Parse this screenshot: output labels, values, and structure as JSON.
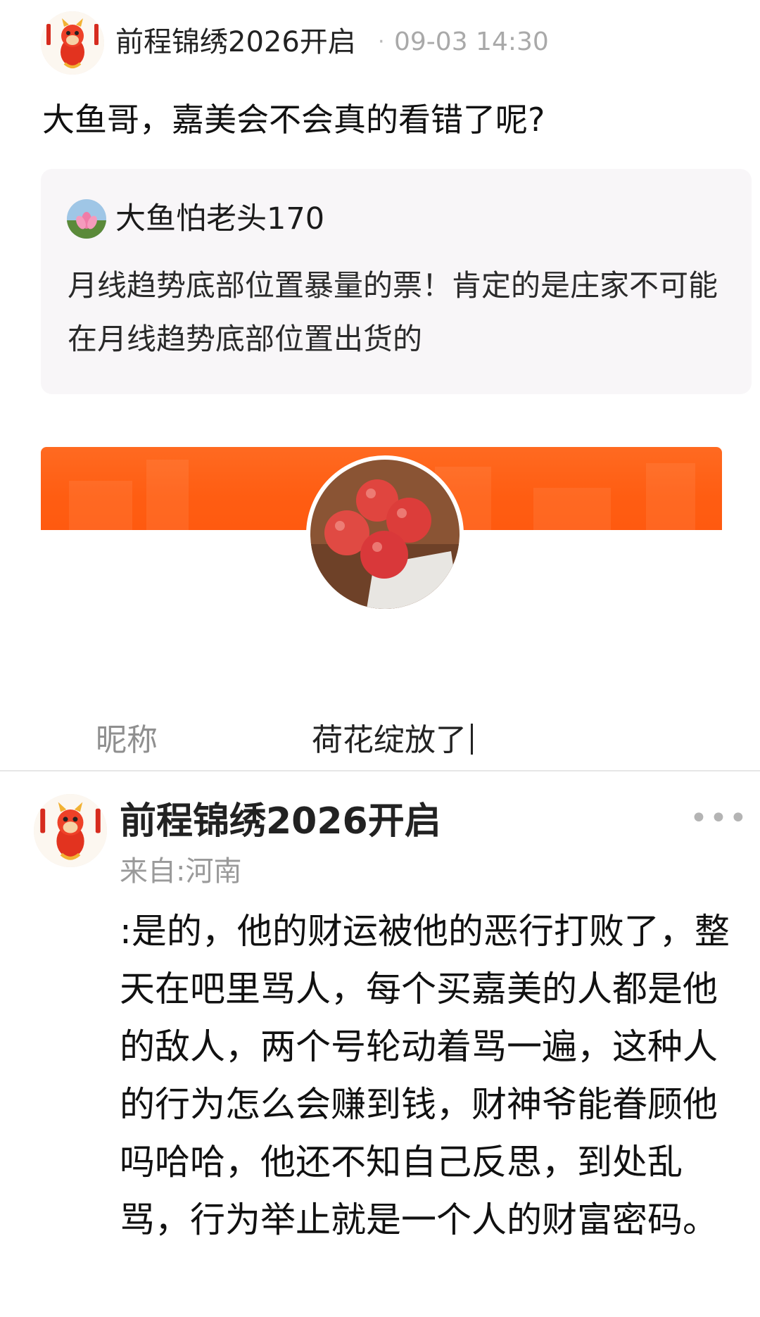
{
  "post": {
    "author": "前程锦绣2026开启",
    "separator": "·",
    "time": "09-03 14:30",
    "text": "大鱼哥，嘉美会不会真的看错了呢?"
  },
  "quote": {
    "author": "大鱼怕老头170",
    "text": "月线趋势底部位置暴量的票！肯定的是庄家不可能在月线趋势底部位置出货的"
  },
  "profile": {
    "banner_color": "#ff5d12",
    "avatar_icon": "red-apples-photo"
  },
  "nickname": {
    "label": "昵称",
    "value": "荷花绽放了"
  },
  "comment": {
    "author": "前程锦绣2026开启",
    "location": "来自:河南",
    "text": ":是的，他的财运被他的恶行打败了，整天在吧里骂人，每个买嘉美的人都是他的敌人，两个号轮动着骂一遍，这种人的行为怎么会赚到钱，财神爷能眷顾他吗哈哈，他还不知自己反思，到处乱骂，行为举止就是一个人的财富密码。",
    "more_icon": "more-dots-icon"
  }
}
